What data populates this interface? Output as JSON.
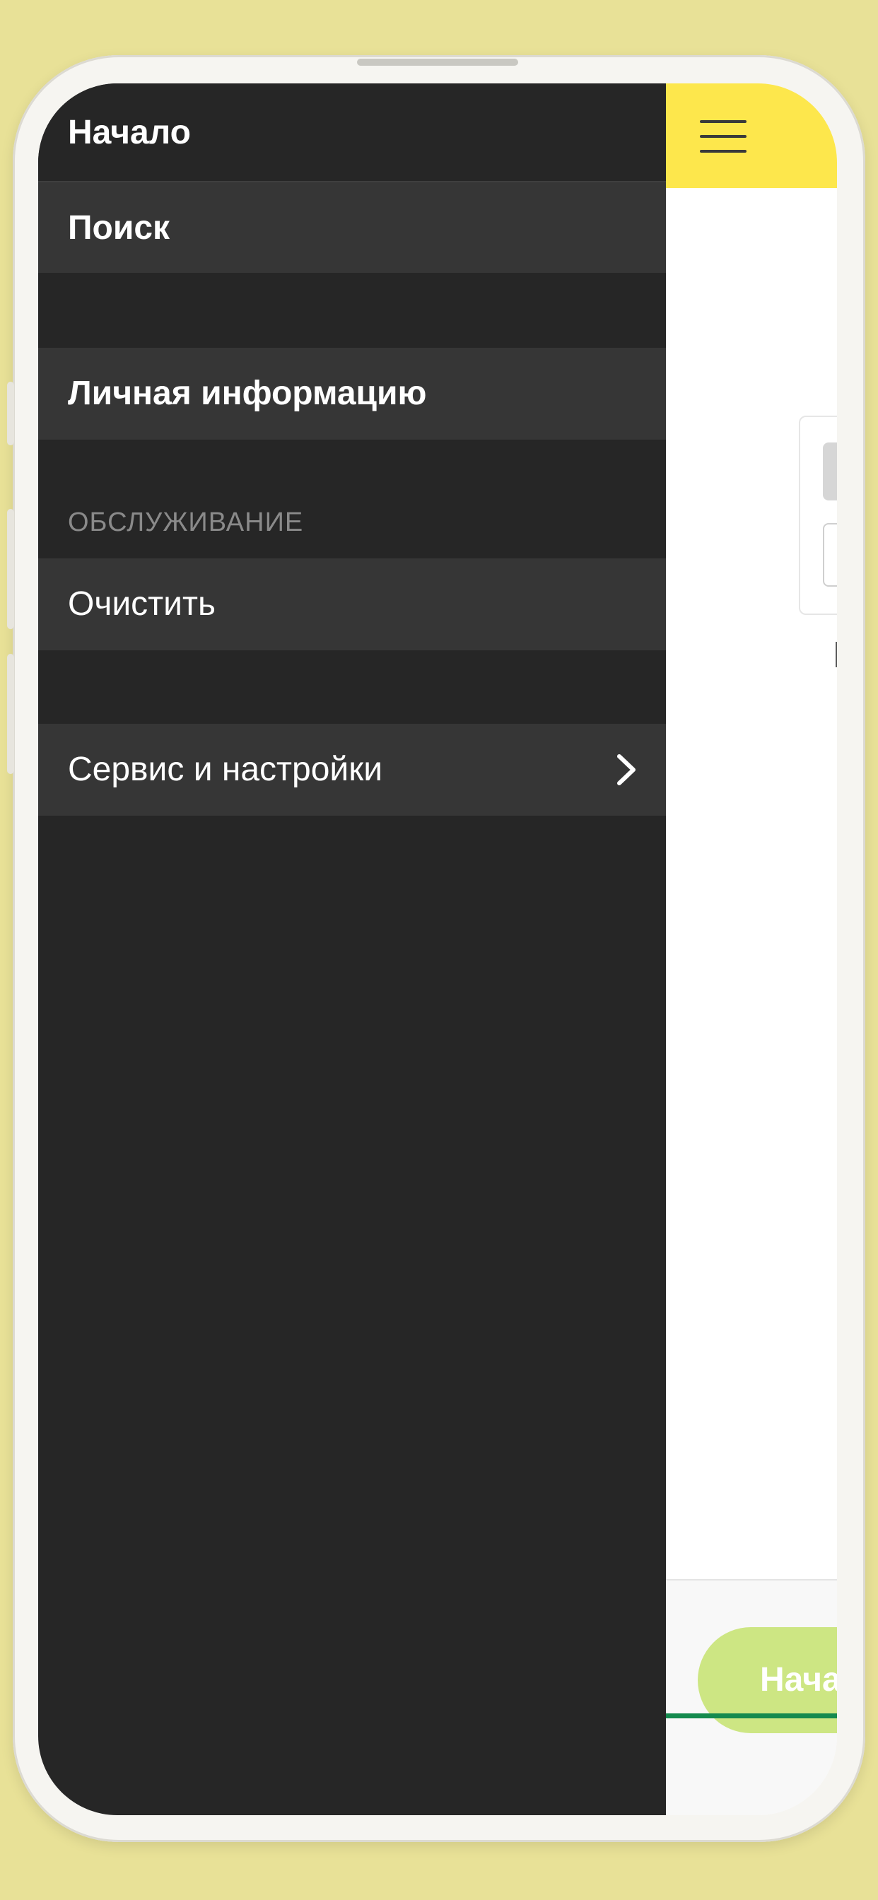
{
  "drawer": {
    "items": [
      {
        "label": "Начало"
      },
      {
        "label": "Поиск"
      },
      {
        "label": "Личная информацию"
      }
    ],
    "section_label": "ОБСЛУЖИВАНИЕ",
    "service_items": [
      {
        "label": "Очистить"
      },
      {
        "label": "Сервис и настройки",
        "icon": "chevron-right-icon"
      }
    ]
  },
  "app": {
    "header_color": "#fde74c",
    "menu_icon": "hamburger-menu-icon",
    "start_button_label": "Начать",
    "accent": "#148a4e",
    "button_color": "#cde683"
  }
}
